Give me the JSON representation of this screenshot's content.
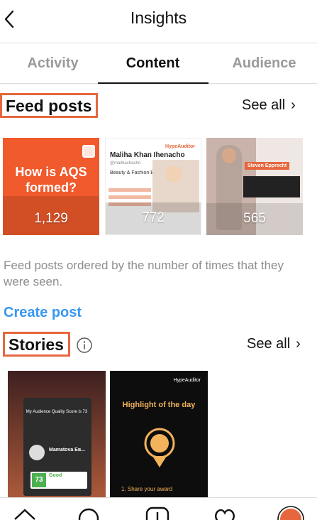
{
  "header": {
    "title": "Insights",
    "back_icon": "chevron-left-icon"
  },
  "tabs": [
    {
      "label": "Activity",
      "active": false
    },
    {
      "label": "Content",
      "active": true
    },
    {
      "label": "Audience",
      "active": false
    }
  ],
  "feed_posts": {
    "title": "Feed posts",
    "see_all_label": "See all",
    "posts": [
      {
        "title_line1": "How is AQS",
        "title_line2": "formed?",
        "count": "1,129"
      },
      {
        "name": "Maliha Khan Ihenacho",
        "handle": "@malihachacho",
        "role": "Beauty & Fashion Blogger",
        "brand": "HypeAuditor",
        "count": "772"
      },
      {
        "name_tag": "Steven Epprecht",
        "count": "565"
      }
    ],
    "caption": "Feed posts ordered by the number of times that they were seen.",
    "create_post_label": "Create post"
  },
  "stories": {
    "title": "Stories",
    "see_all_label": "See all",
    "items": [
      {
        "text": "My Audience Quality Score is 73",
        "user": "Мamatova Ев...",
        "score": "73",
        "score_label": "Good"
      },
      {
        "brand": "HypeAuditor",
        "headline": "Highlight of the day",
        "step": "1. Share your award"
      }
    ]
  },
  "colors": {
    "accent": "#e6673e",
    "link": "#3797f0",
    "muted": "#8e8e8e"
  },
  "bottom_nav": [
    "home-icon",
    "search-icon",
    "add-icon",
    "heart-icon",
    "profile-icon"
  ]
}
